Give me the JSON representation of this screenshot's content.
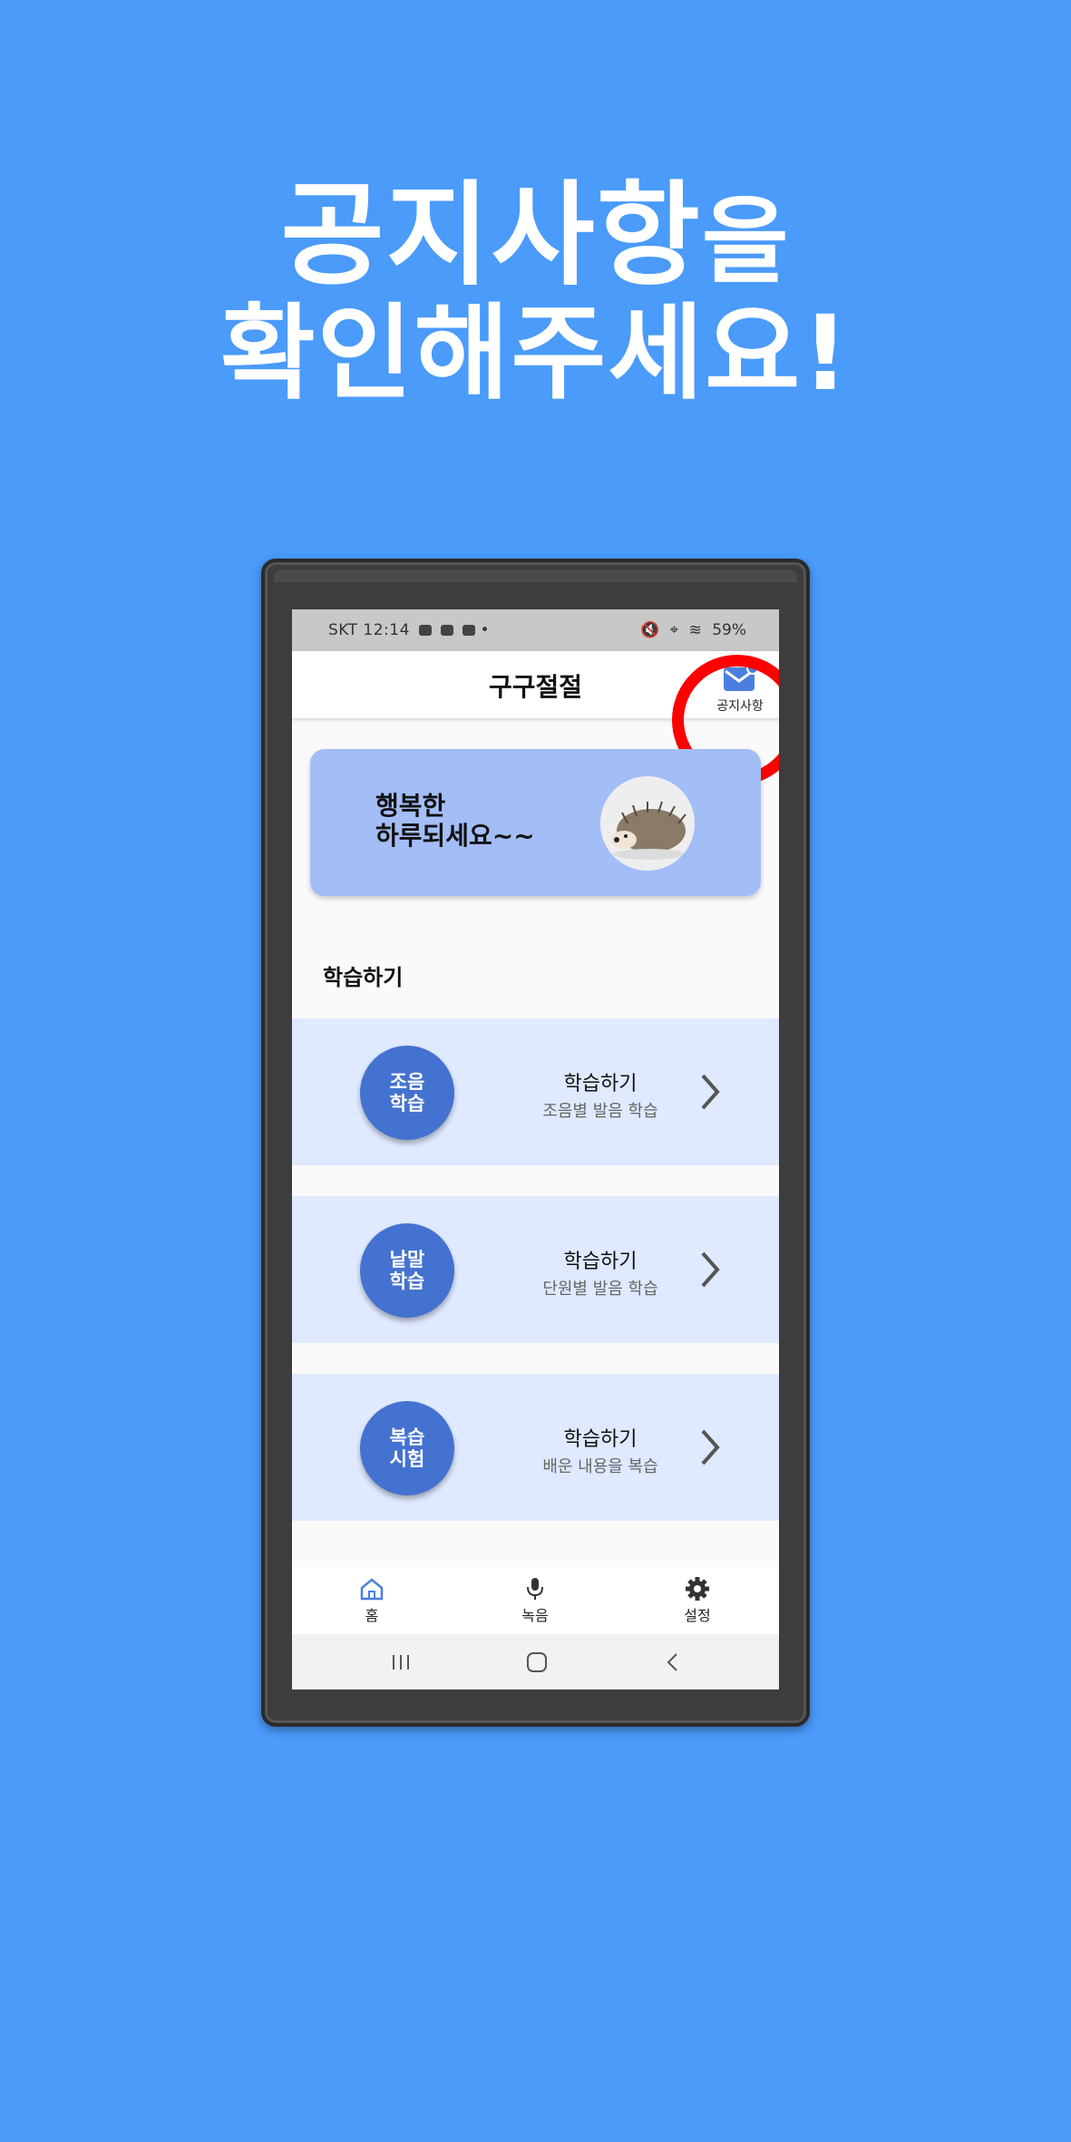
{
  "headline": {
    "line1_main": "공지사항",
    "line1_suffix": "을",
    "line2": "확인해주세요!"
  },
  "status_bar": {
    "carrier_time": "SKT 12:14",
    "battery": "59%"
  },
  "app_bar": {
    "title": "구구절절",
    "notice_label": "공지사항"
  },
  "greeting": {
    "text": "행복한\n하루되세요~~"
  },
  "section": {
    "title": "학습하기"
  },
  "study_items": [
    {
      "badge": "조음\n학습",
      "title": "학습하기",
      "subtitle": "조음별 발음 학습"
    },
    {
      "badge": "낱말\n학습",
      "title": "학습하기",
      "subtitle": "단원별 발음 학습"
    },
    {
      "badge": "복습\n시험",
      "title": "학습하기",
      "subtitle": "배운 내용을 복습"
    }
  ],
  "bottom_nav": {
    "home": "홈",
    "record": "녹음",
    "settings": "설정"
  },
  "colors": {
    "background": "#4a9bfa",
    "accent": "#4472d0",
    "card": "#a3bdf7",
    "row": "#dfe9ff",
    "highlight": "#ff0000"
  }
}
